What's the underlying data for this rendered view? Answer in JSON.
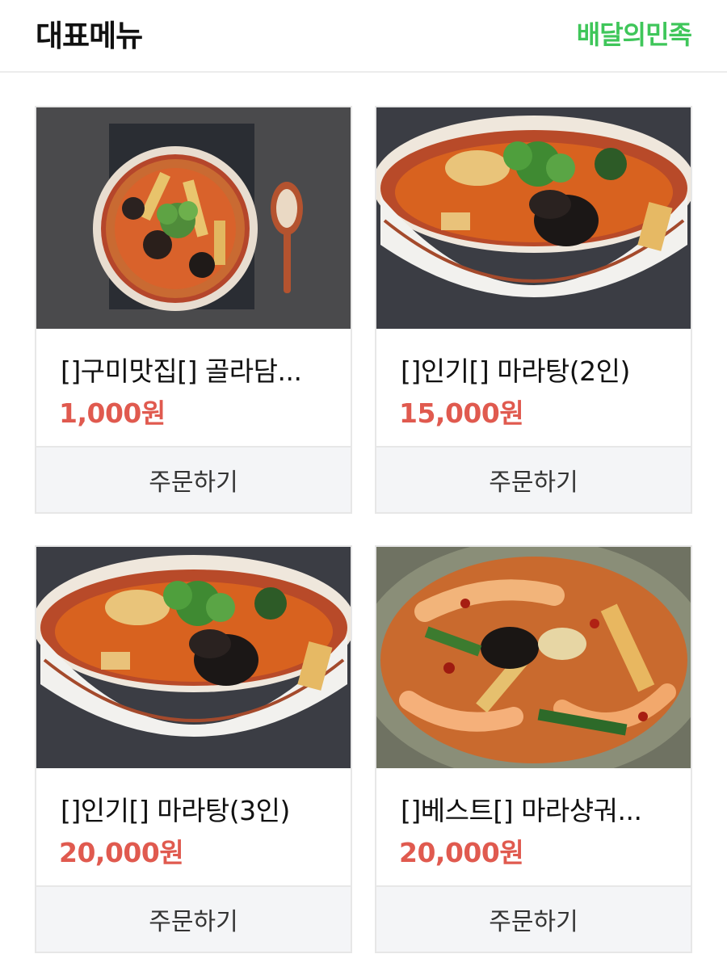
{
  "header": {
    "title": "대표메뉴",
    "brand": "배달의민족",
    "brand_color": "#3fc65a"
  },
  "price_color": "#e05a4f",
  "menu": [
    {
      "name": "[]구미맛집[] 골라담...",
      "price": "1,000원",
      "order_label": "주문하기",
      "image": "soup-bowl-top-view"
    },
    {
      "name": "[]인기[] 마라탕(2인)",
      "price": "15,000원",
      "order_label": "주문하기",
      "image": "mala-soup-bowl"
    },
    {
      "name": "[]인기[] 마라탕(3인)",
      "price": "20,000원",
      "order_label": "주문하기",
      "image": "mala-soup-bowl"
    },
    {
      "name": "[]베스트[] 마라샹궈...",
      "price": "20,000원",
      "order_label": "주문하기",
      "image": "mala-xiangguo-plate"
    }
  ]
}
